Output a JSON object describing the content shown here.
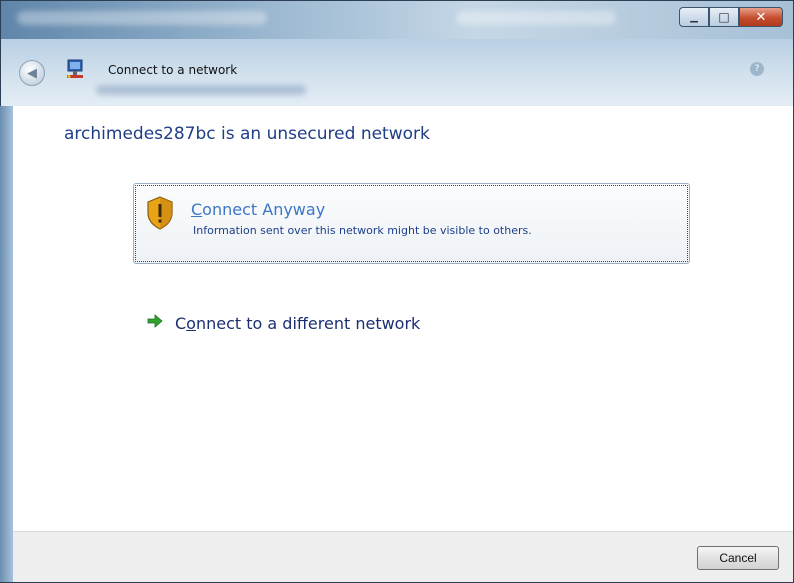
{
  "window": {
    "minimize_glyph": "▁",
    "maximize_glyph": "□",
    "close_glyph": "✕"
  },
  "nav": {
    "back_glyph": "◀",
    "title": "Connect to a network",
    "help_glyph": "?"
  },
  "heading": "archimedes287bc is an unsecured network",
  "connect_anyway": {
    "title_accel": "C",
    "title_rest": "onnect Anyway",
    "description": "Information sent over this network might be visible to others."
  },
  "different_network": {
    "pre": "C",
    "accel": "o",
    "rest": "nnect to a different network"
  },
  "footer": {
    "cancel_label": "Cancel"
  },
  "colors": {
    "heading": "#1f3d86",
    "link_title": "#3c77c6",
    "link_desc": "#1d3f88",
    "shield": "#e8a317",
    "arrow": "#2fa52f"
  },
  "icons": {
    "back": "back-arrow-icon",
    "network": "network-icon",
    "shield": "security-shield-icon",
    "arrow": "green-arrow-icon"
  }
}
